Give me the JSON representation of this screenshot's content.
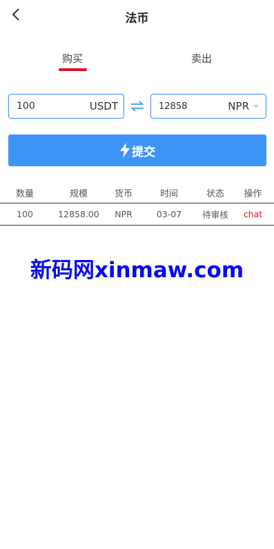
{
  "header": {
    "title": "法币"
  },
  "tabs": [
    {
      "label": "购买"
    },
    {
      "label": "卖出"
    }
  ],
  "form": {
    "amount_value": "100",
    "amount_unit": "USDT",
    "converted_value": "12858",
    "currency": "NPR",
    "submit_label": "提交"
  },
  "table": {
    "headers": [
      "数量",
      "规模",
      "货币",
      "时间",
      "状态",
      "操作"
    ],
    "rows": [
      {
        "quantity": "100",
        "scale": "12858.00",
        "currency": "NPR",
        "time": "03-07",
        "status": "待审核",
        "action": "chat"
      }
    ]
  },
  "watermark": "新码网xinmaw.com",
  "colors": {
    "accent": "#3f95f7",
    "tab_indicator": "#e0102d",
    "chat_link": "#e0102d",
    "watermark": "#0a0af0"
  },
  "icons": {
    "back": "chevron-left-icon",
    "swap": "swap-arrows-icon",
    "submit": "lightning-icon",
    "select": "caret-down-icon"
  }
}
